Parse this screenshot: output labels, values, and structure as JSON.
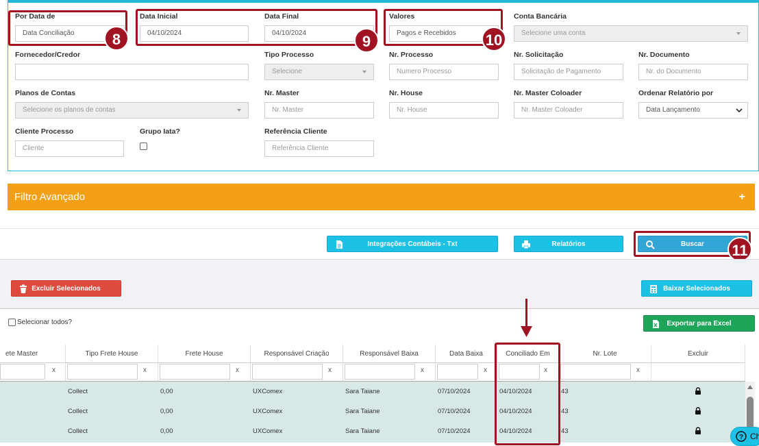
{
  "filters": {
    "por_data_de": {
      "label": "Por Data de",
      "value": "Data Conciliação"
    },
    "data_inicial": {
      "label": "Data Inicial",
      "value": "04/10/2024"
    },
    "data_final": {
      "label": "Data Final",
      "value": "04/10/2024"
    },
    "valores": {
      "label": "Valores",
      "value": "Pagos e Recebidos"
    },
    "conta_bancaria": {
      "label": "Conta Bancária",
      "placeholder": "Selecione uma conta"
    },
    "fornecedor": {
      "label": "Fornecedor/Credor",
      "value": ""
    },
    "tipo_processo": {
      "label": "Tipo Processo",
      "placeholder": "Selecione"
    },
    "nr_processo": {
      "label": "Nr. Processo",
      "placeholder": "Numero Processo"
    },
    "nr_solicitacao": {
      "label": "Nr. Solicitação",
      "placeholder": "Solicitação de Pagamento"
    },
    "nr_documento": {
      "label": "Nr. Documento",
      "placeholder": "Nr. do Documento"
    },
    "planos_contas": {
      "label": "Planos de Contas",
      "placeholder": "Selecione os planos de contas"
    },
    "nr_master": {
      "label": "Nr. Master",
      "placeholder": "Nr. Master"
    },
    "nr_house": {
      "label": "Nr. House",
      "placeholder": "Nr. House"
    },
    "nr_master_coloader": {
      "label": "Nr. Master Coloader",
      "placeholder": "Nr. Master Coloader"
    },
    "ordenar": {
      "label": "Ordenar Relatório por",
      "value": "Data Lançamento"
    },
    "cliente_processo": {
      "label": "Cliente Processo",
      "placeholder": "Cliente"
    },
    "grupo_iata": {
      "label": "Grupo Iata?",
      "checked": false
    },
    "referencia_cliente": {
      "label": "Referência Cliente",
      "placeholder": "Referência Cliente"
    }
  },
  "badges": {
    "b8": "8",
    "b9": "9",
    "b10": "10",
    "b11": "11"
  },
  "advanced": {
    "label": "Filtro Avançado",
    "toggle": "+"
  },
  "actions": {
    "integracoes": "Integrações Contábeis - Txt",
    "relatorios": "Relatórios",
    "buscar": "Buscar",
    "excluir": "Excluir Selecionados",
    "baixar": "Baixar Selecionados",
    "selecionar_todos": "Selecionar todos?",
    "exportar": "Exportar para Excel"
  },
  "grid": {
    "columns": [
      "ete Master",
      "Tipo Frete House",
      "Frete House",
      "Responsável Criação",
      "Responsável Baixa",
      "Data Baixa",
      "Conciliado Em",
      "Nr. Lote",
      "Excluir"
    ],
    "filter_clear": "x",
    "rows": [
      {
        "tipo_frete_house": "Collect",
        "frete_house": "0,00",
        "resp_criacao": "UXComex",
        "resp_baixa": "Sara Taiane",
        "data_baixa": "07/10/2024",
        "conciliado_em": "04/10/2024",
        "nr_lote": "43"
      },
      {
        "tipo_frete_house": "Collect",
        "frete_house": "0,00",
        "resp_criacao": "UXComex",
        "resp_baixa": "Sara Taiane",
        "data_baixa": "07/10/2024",
        "conciliado_em": "04/10/2024",
        "nr_lote": "43"
      },
      {
        "tipo_frete_house": "Collect",
        "frete_house": "0,00",
        "resp_criacao": "UXComex",
        "resp_baixa": "Sara Taiane",
        "data_baixa": "07/10/2024",
        "conciliado_em": "04/10/2024",
        "nr_lote": "43"
      }
    ]
  },
  "chat": {
    "label": "Ch"
  },
  "colors": {
    "accent": "#1ec1e6",
    "highlight": "#a01322",
    "orange": "#f4a017",
    "danger": "#e04b3f",
    "success": "#1fa55a"
  }
}
